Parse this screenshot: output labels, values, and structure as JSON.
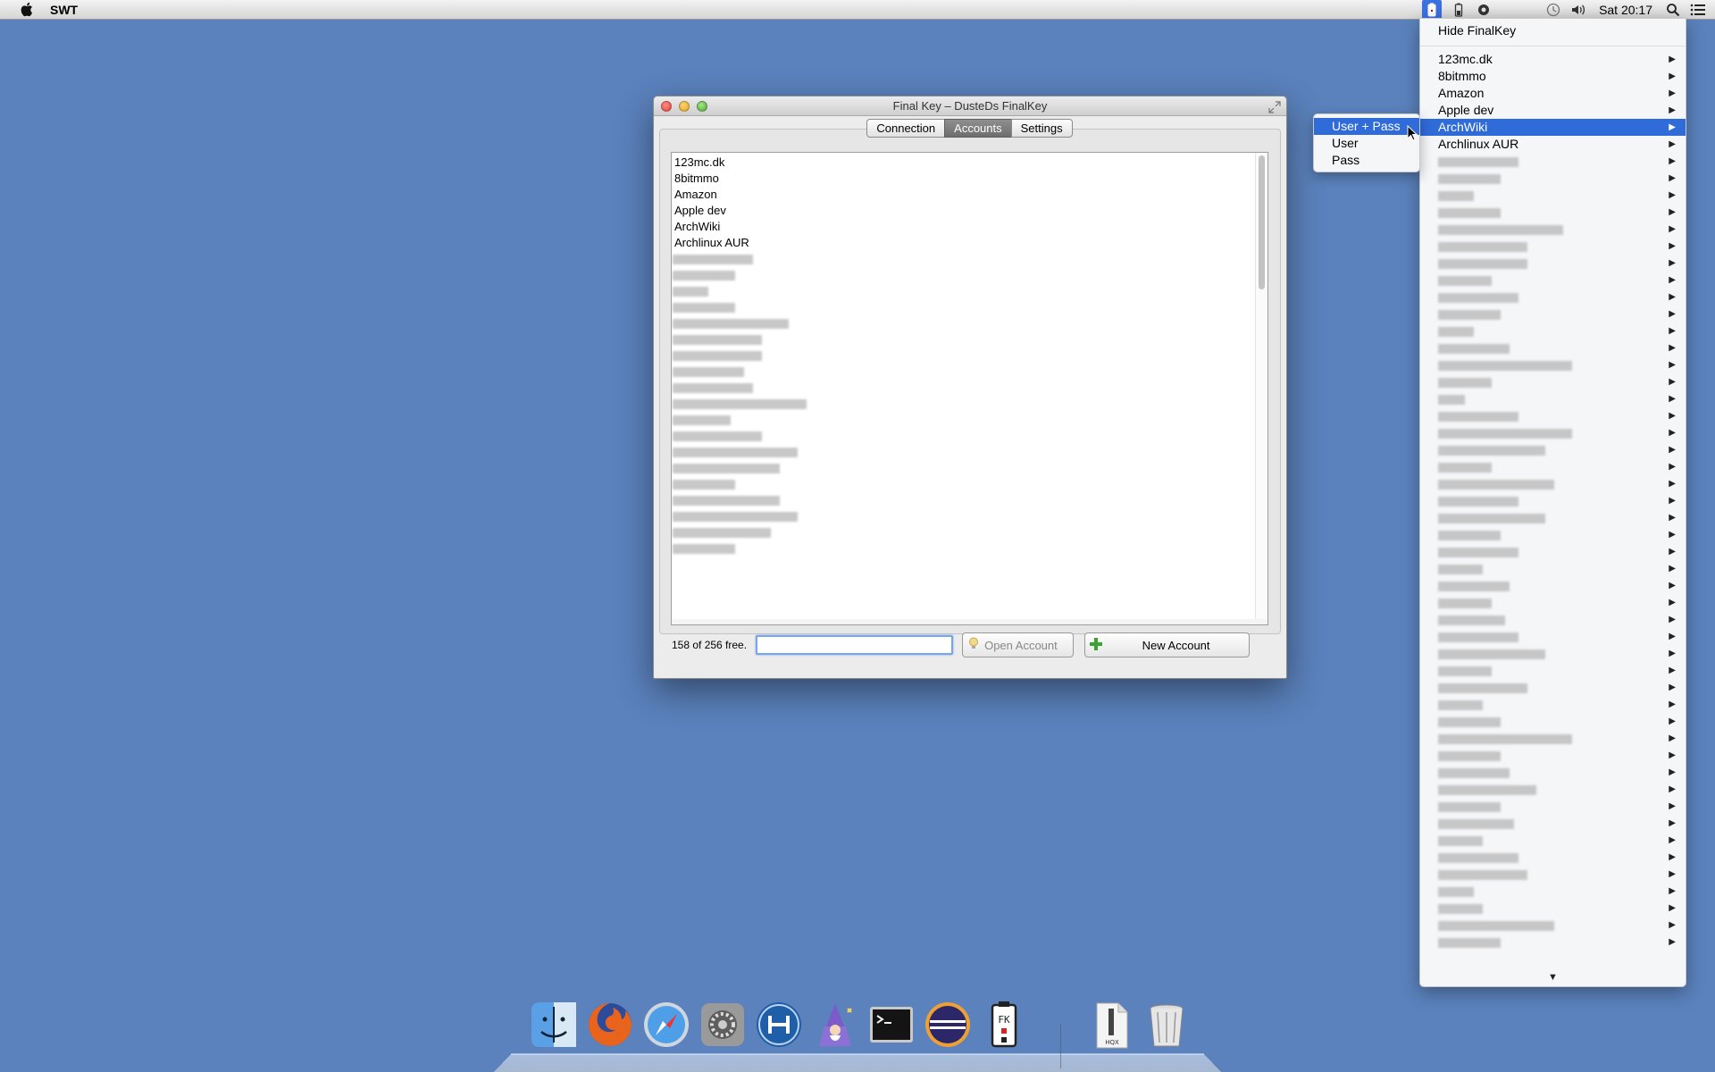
{
  "menubar": {
    "app_name": "SWT",
    "clock": "Sat 20:17",
    "icons": [
      "apple-icon",
      "finalkey-status-icon",
      "battery-icon",
      "gear-status-icon",
      "time-machine-icon",
      "volume-icon",
      "spotlight-icon",
      "notification-center-icon"
    ]
  },
  "window": {
    "title": "Final Key – DusteDs FinalKey",
    "tabs": [
      {
        "label": "Connection",
        "active": false
      },
      {
        "label": "Accounts",
        "active": true
      },
      {
        "label": "Settings",
        "active": false
      }
    ],
    "accounts": [
      "123mc.dk",
      "8bitmmo",
      "Amazon",
      "Apple dev",
      "ArchWiki",
      "Archlinux AUR"
    ],
    "free_count": "158 of 256 free.",
    "search_value": "",
    "open_account_label": "Open Account",
    "new_account_label": "New Account"
  },
  "menu": {
    "hide_label": "Hide FinalKey",
    "items": [
      "123mc.dk",
      "8bitmmo",
      "Amazon",
      "Apple dev",
      "ArchWiki",
      "Archlinux AUR"
    ],
    "highlighted": "ArchWiki",
    "arrow": "▶",
    "scroll_arrow": "▼"
  },
  "submenu": {
    "items": [
      "User + Pass",
      "User",
      "Pass"
    ],
    "highlighted": "User + Pass"
  },
  "dock": {
    "apps": [
      "finder-icon",
      "firefox-icon",
      "safari-icon",
      "system-preferences-icon",
      "arduino-icon",
      "wizard-app-icon",
      "terminal-icon",
      "eclipse-icon",
      "finalkey-app-icon",
      "hqx-document-icon",
      "trash-icon"
    ]
  },
  "colors": {
    "desktop": "#5b82bd",
    "highlight": "#2f6bd9",
    "focus_ring": "#78a5e6"
  }
}
